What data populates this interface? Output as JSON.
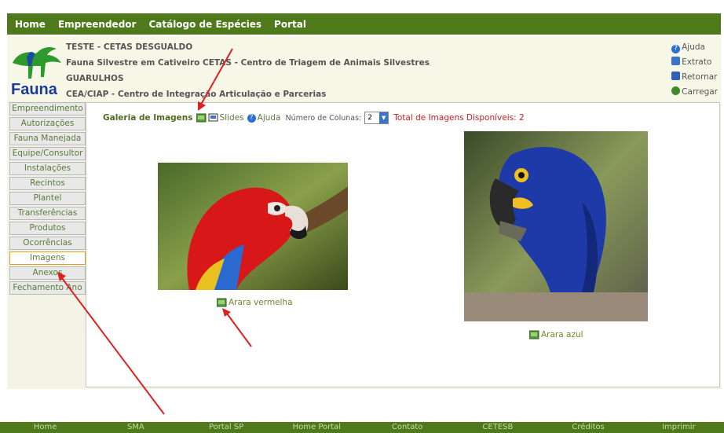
{
  "topnav": [
    "Home",
    "Empreendedor",
    "Catálogo de Espécies",
    "Portal"
  ],
  "header": {
    "logo_text": "Fauna",
    "lines": [
      "TESTE - CETAS DESGUALDO",
      "Fauna Silvestre em Cativeiro CETAS - Centro de Triagem de Animais Silvestres",
      "GUARULHOS",
      "CEA/CIAP - Centro de Integração Articulação e Parcerias"
    ],
    "right_links": [
      {
        "label": "Ajuda",
        "icon": "help-icon"
      },
      {
        "label": "Extrato",
        "icon": "document-icon"
      },
      {
        "label": "Retornar",
        "icon": "return-icon"
      },
      {
        "label": "Carregar",
        "icon": "load-icon"
      }
    ]
  },
  "sidebar": [
    {
      "label": "Empreendimento"
    },
    {
      "label": "Autorizações"
    },
    {
      "label": "Fauna Manejada"
    },
    {
      "label": "Equipe/Consultor"
    },
    {
      "label": "Instalações"
    },
    {
      "label": "Recintos"
    },
    {
      "label": "Plantel"
    },
    {
      "label": "Transferências"
    },
    {
      "label": "Produtos"
    },
    {
      "label": "Ocorrências"
    },
    {
      "label": "Imagens",
      "active": true
    },
    {
      "label": "Anexos"
    },
    {
      "label": "Fechamento Ano"
    }
  ],
  "gallery": {
    "title": "Galeria de Imagens",
    "slides": "Slides",
    "help": "Ajuda",
    "columns_label": "Número de Colunas:",
    "columns_value": "2",
    "total": "Total de Imagens Disponíveis: 2",
    "images": [
      {
        "caption": "Arara vermelha"
      },
      {
        "caption": "Arara azul"
      }
    ]
  },
  "footer": [
    "Home",
    "SMA",
    "Portal SP",
    "Home Portal",
    "Contato",
    "CETESB",
    "Créditos",
    "Imprimir"
  ],
  "colors": {
    "brand_green": "#4e7a1b",
    "arrow_red": "#e02020",
    "total_red": "#c82020"
  }
}
